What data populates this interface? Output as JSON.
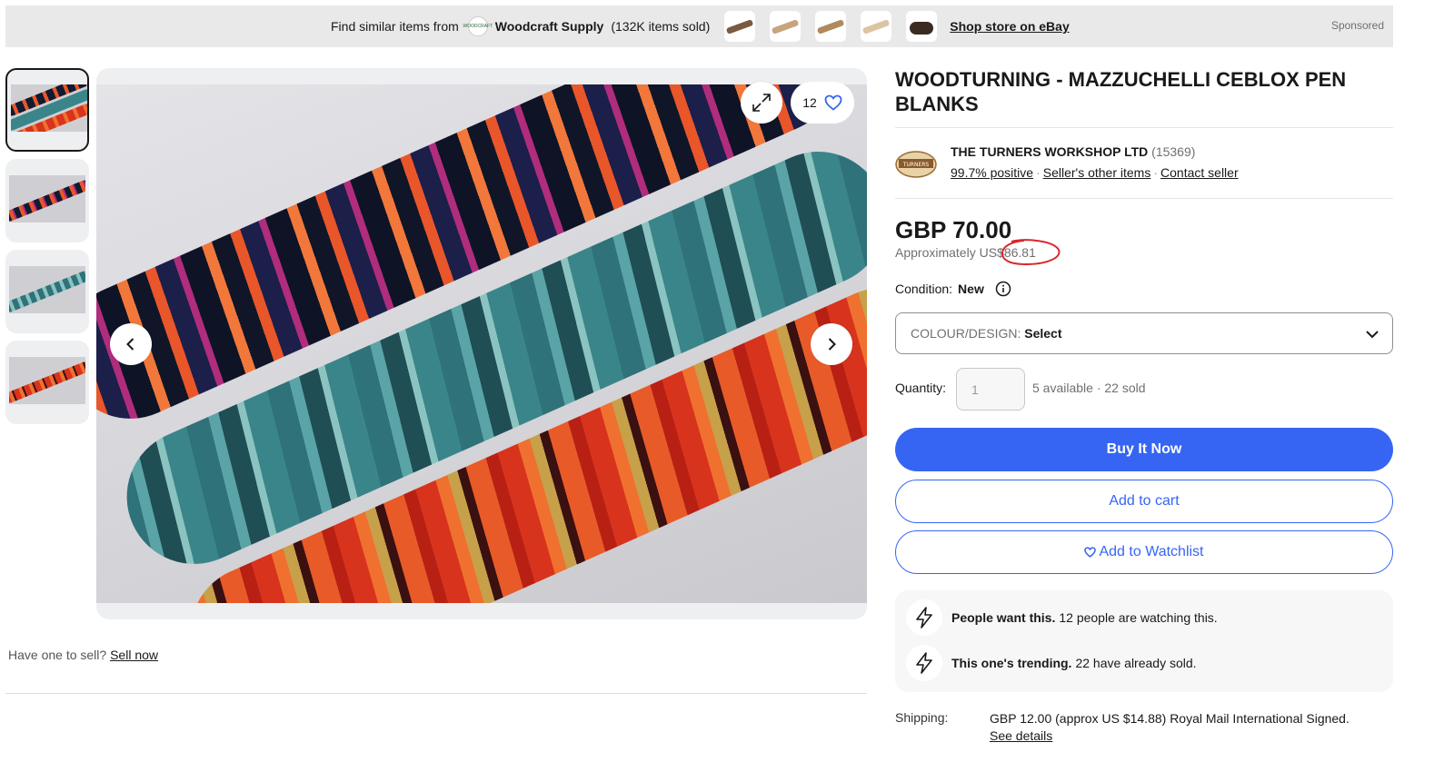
{
  "banner": {
    "prefix": "Find similar items from",
    "store_name": "Woodcraft Supply",
    "store_logo_text": "WOODCRAFT",
    "items_sold": "(132K items sold)",
    "shop_link": "Shop store on eBay",
    "sponsored": "Sponsored"
  },
  "gallery": {
    "watch_count": "12",
    "thumbnails": [
      "thumb-1",
      "thumb-2",
      "thumb-3",
      "thumb-4"
    ]
  },
  "sell": {
    "prompt": "Have one to sell?",
    "link": "Sell now"
  },
  "item": {
    "title": "WOODTURNING - MAZZUCHELLI CEBLOX PEN BLANKS"
  },
  "seller": {
    "logo_text": "TURNERS",
    "name": "THE TURNERS WORKSHOP LTD",
    "feedback_count": "(15369)",
    "positive": "99.7% positive",
    "other_items": "Seller's other items",
    "contact": "Contact seller"
  },
  "price": {
    "main": "GBP 70.00",
    "approx_prefix": "Approximately US",
    "approx_value": "$86.81"
  },
  "condition": {
    "label": "Condition:",
    "value": "New"
  },
  "variant": {
    "label": "COLOUR/DESIGN:",
    "value": "Select"
  },
  "quantity": {
    "label": "Quantity:",
    "value": "1",
    "available": "5 available · 22 sold"
  },
  "buttons": {
    "buy_now": "Buy It Now",
    "add_to_cart": "Add to cart",
    "watchlist": "Add to Watchlist"
  },
  "signals": [
    {
      "bold": "People want this.",
      "text": "12 people are watching this."
    },
    {
      "bold": "This one's trending.",
      "text": "22 have already sold."
    }
  ],
  "shipping": {
    "label": "Shipping:",
    "text": "GBP 12.00 (approx US $14.88) Royal Mail International Signed.",
    "details_link": "See details"
  },
  "colors": {
    "brand_blue": "#3665f3",
    "annotation_red": "#d8262b",
    "banner_bg": "#e9e9ea"
  }
}
